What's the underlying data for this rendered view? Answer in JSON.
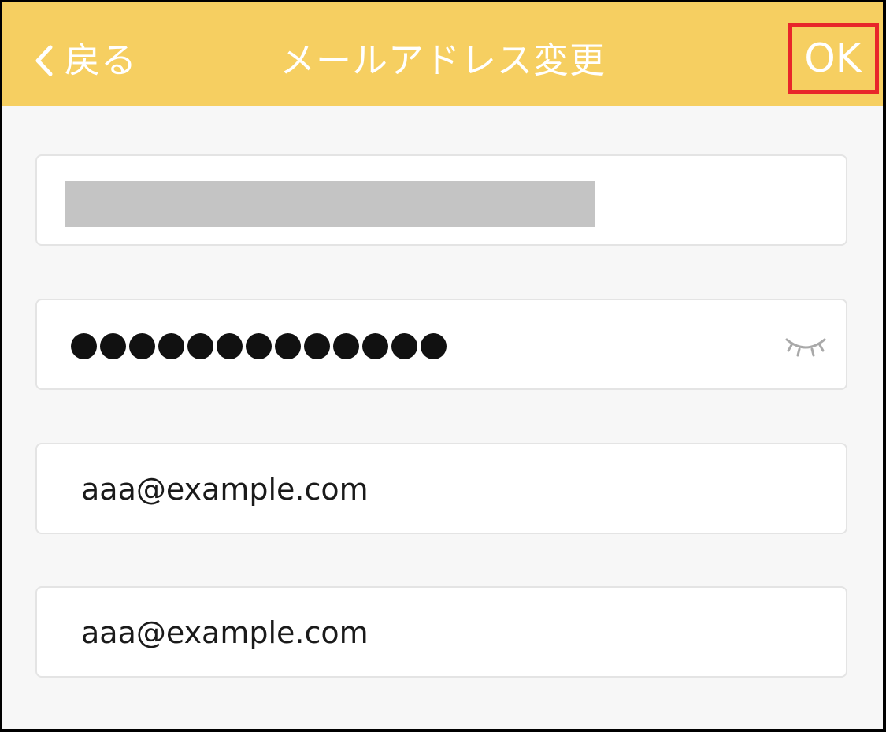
{
  "navbar": {
    "back_label": "戻る",
    "title": "メールアドレス変更",
    "ok_label": "OK",
    "background_color": "#f6cf61",
    "highlight_color": "#e8262a"
  },
  "form": {
    "current_email": {
      "value_redacted": true
    },
    "password": {
      "masked_length": 13,
      "toggle_icon": "eye-closed-icon"
    },
    "new_email": {
      "value": "aaa@example.com"
    },
    "confirm_email": {
      "value": "aaa@example.com"
    }
  }
}
